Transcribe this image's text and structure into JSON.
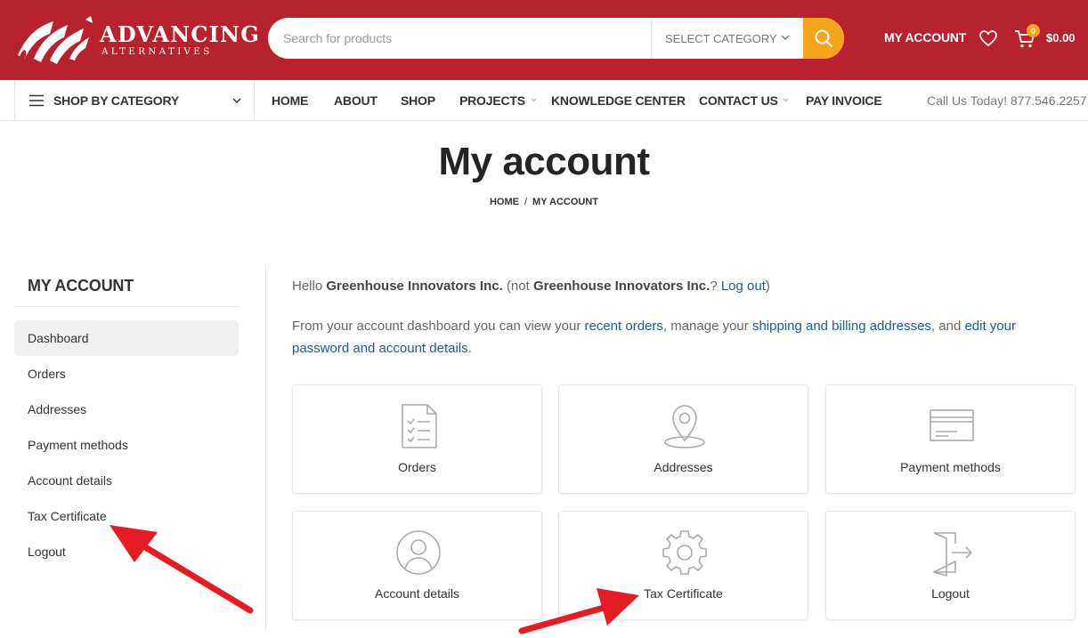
{
  "header": {
    "logo_title": "ADVANCING",
    "logo_subtitle": "ALTERNATIVES",
    "search_placeholder": "Search for products",
    "search_category": "SELECT CATEGORY",
    "account_label": "MY ACCOUNT",
    "cart_count": "0",
    "cart_total": "$0.00",
    "brand_color": "#b8222f",
    "accent_color": "#f5a51c"
  },
  "nav": {
    "shop_by_category": "SHOP BY CATEGORY",
    "items": [
      "HOME",
      "ABOUT",
      "SHOP",
      "PROJECTS",
      "KNOWLEDGE CENTER",
      "CONTACT US",
      "PAY INVOICE"
    ],
    "call": "Call Us Today! 877.546.2257"
  },
  "page": {
    "title": "My account",
    "breadcrumb": [
      "HOME",
      "/",
      "MY ACCOUNT"
    ]
  },
  "sidebar": {
    "title": "MY ACCOUNT",
    "items": [
      "Dashboard",
      "Orders",
      "Addresses",
      "Payment methods",
      "Account details",
      "Tax Certificate",
      "Logout"
    ],
    "active": "Dashboard"
  },
  "main": {
    "hello_prefix": "Hello ",
    "user_name": "Greenhouse Innovators Inc.",
    "hello_not": " (not ",
    "user_name_2": "Greenhouse Innovators Inc.",
    "hello_q": "? ",
    "logout_link": "Log out",
    "hello_end": ")",
    "intro_1": "From your account dashboard you can view your ",
    "link_orders": "recent orders",
    "intro_2": ", manage your ",
    "link_addresses": "shipping and billing addresses",
    "intro_3": ", and ",
    "link_password": "edit your password and account details",
    "intro_4": ".",
    "cards": [
      {
        "label": "Orders",
        "icon": "clipboard-list-icon"
      },
      {
        "label": "Addresses",
        "icon": "map-pin-icon"
      },
      {
        "label": "Payment methods",
        "icon": "credit-card-icon"
      },
      {
        "label": "Account details",
        "icon": "user-circle-icon"
      },
      {
        "label": "Tax Certificate",
        "icon": "gear-icon"
      },
      {
        "label": "Logout",
        "icon": "door-exit-icon"
      }
    ]
  }
}
